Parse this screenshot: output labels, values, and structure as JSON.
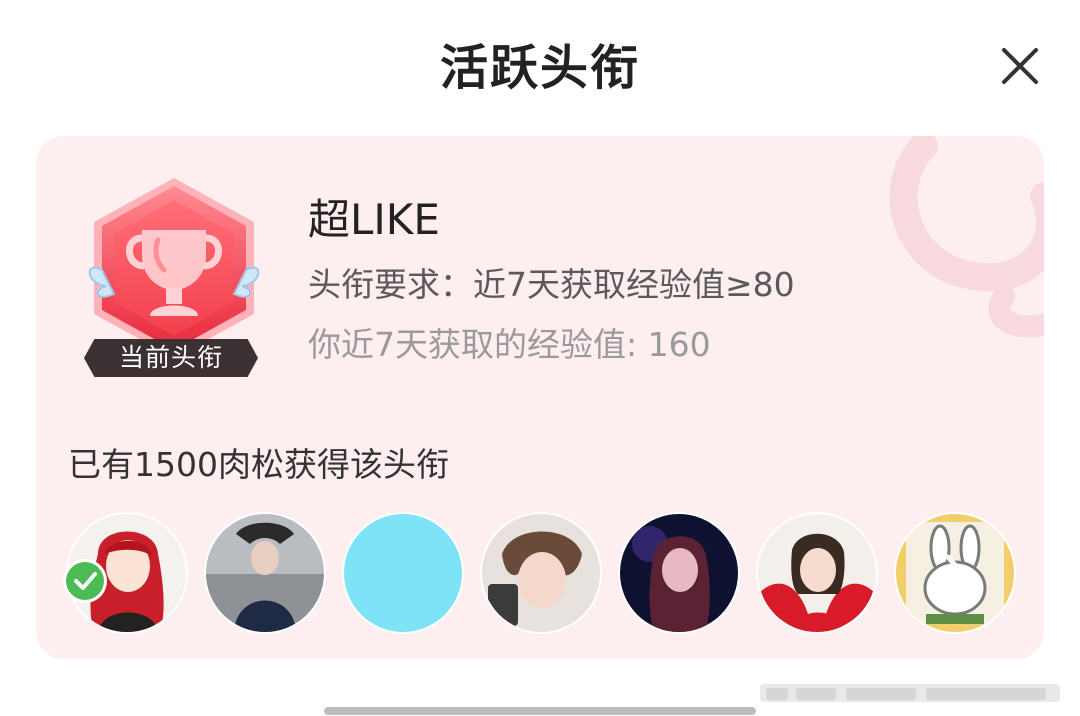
{
  "sheet": {
    "title": "活跃头衔",
    "close_icon": "close-icon"
  },
  "badge": {
    "icon": "trophy-badge-icon",
    "current_label": "当前头衔",
    "name": "超LIKE",
    "requirement": "头衔要求：近7天获取经验值≥80",
    "your_exp": "你近7天获取的经验值: 160"
  },
  "holders": {
    "text": "已有1500肉松获得该头衔",
    "avatars": [
      {
        "name": "avatar-1",
        "verified": true
      },
      {
        "name": "avatar-2"
      },
      {
        "name": "avatar-3"
      },
      {
        "name": "avatar-4"
      },
      {
        "name": "avatar-5"
      },
      {
        "name": "avatar-6"
      },
      {
        "name": "avatar-7",
        "more_icon": "chevron-right-icon"
      }
    ]
  },
  "colors": {
    "card_bg": "#fdeef0",
    "badge_red": "#f0404a",
    "title_text": "#222222"
  }
}
